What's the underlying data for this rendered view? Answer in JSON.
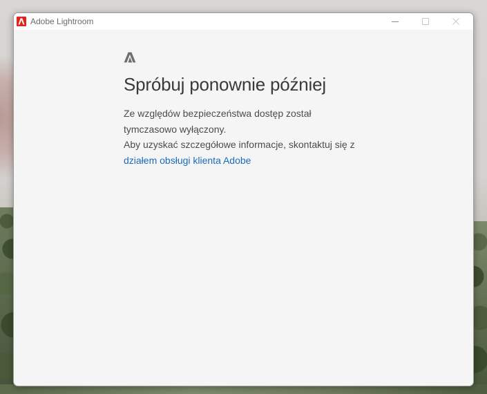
{
  "window": {
    "title": "Adobe Lightroom",
    "controls": {
      "minimize_icon": "minimize-icon",
      "maximize_icon": "maximize-icon",
      "close_icon": "close-icon"
    }
  },
  "error": {
    "icon": "adobe-logo-icon",
    "heading": "Spróbuj ponownie później",
    "line1": "Ze względów bezpieczeństwa dostęp został",
    "line2": "tymczasowo wyłączony.",
    "line3": "Aby uzyskać szczegółowe informacje, skontaktuj się z",
    "link_text": "działem obsługi klienta Adobe"
  },
  "colors": {
    "accent_link": "#1a6bb8",
    "adobe_red": "#e1251b",
    "window_bg": "#f5f5f5"
  }
}
